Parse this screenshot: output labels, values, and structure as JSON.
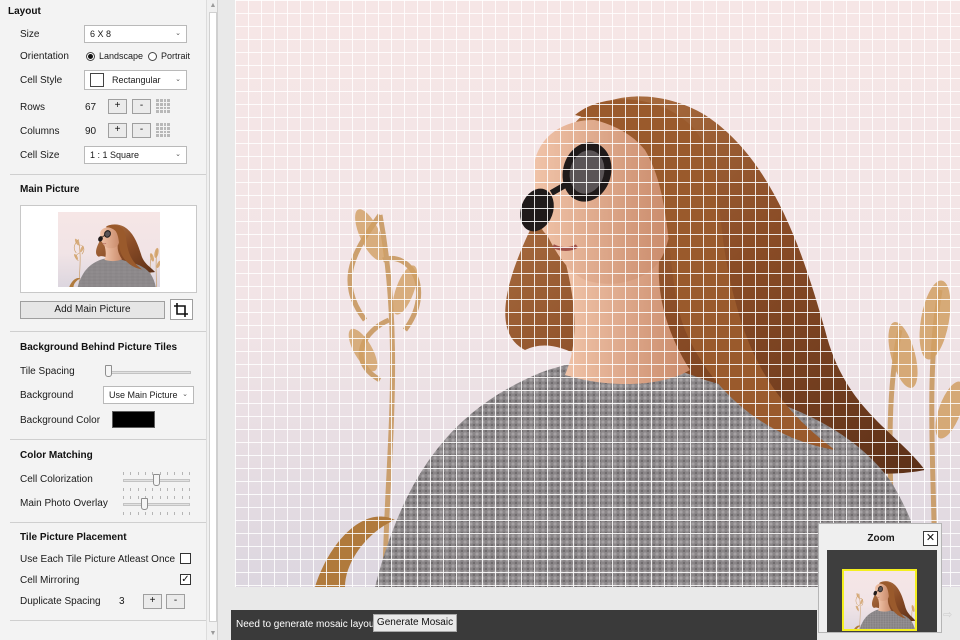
{
  "layout": {
    "title": "Layout",
    "size_label": "Size",
    "size_value": "6 X 8",
    "orientation_label": "Orientation",
    "orientation_options": [
      "Landscape",
      "Portrait"
    ],
    "orientation_selected": "Landscape",
    "cell_style_label": "Cell Style",
    "cell_style_value": "Rectangular",
    "rows_label": "Rows",
    "rows_value": "67",
    "columns_label": "Columns",
    "columns_value": "90",
    "cell_size_label": "Cell Size",
    "cell_size_value": "1 : 1 Square",
    "plus_label": "+",
    "minus_label": "-"
  },
  "main_picture": {
    "title": "Main Picture",
    "add_button_label": "Add Main Picture"
  },
  "background": {
    "title": "Background Behind Picture Tiles",
    "tile_spacing_label": "Tile Spacing",
    "tile_spacing_level": 0,
    "background_label": "Background",
    "background_value": "Use Main Picture",
    "background_color_label": "Background Color",
    "background_color_value": "#000000"
  },
  "color_matching": {
    "title": "Color Matching",
    "cell_colorization_label": "Cell Colorization",
    "cell_colorization_level": 0.5,
    "main_photo_overlay_label": "Main Photo Overlay",
    "main_photo_overlay_level": 0.3
  },
  "tile_placement": {
    "title": "Tile Picture Placement",
    "use_each_label": "Use Each Tile Picture Atleast Once",
    "use_each_checked": false,
    "cell_mirroring_label": "Cell Mirroring",
    "cell_mirroring_checked": true,
    "duplicate_spacing_label": "Duplicate Spacing",
    "duplicate_spacing_value": "3"
  },
  "status_bar": {
    "message": "Need to generate mosaic layout",
    "generate_label": "Generate Mosaic"
  },
  "zoom": {
    "title": "Zoom",
    "close_label": "✕",
    "frame_color": "#f4ef1f"
  },
  "colors": {
    "panel_bg": "#f3f3f3",
    "status_bg": "#3a3a3a"
  }
}
